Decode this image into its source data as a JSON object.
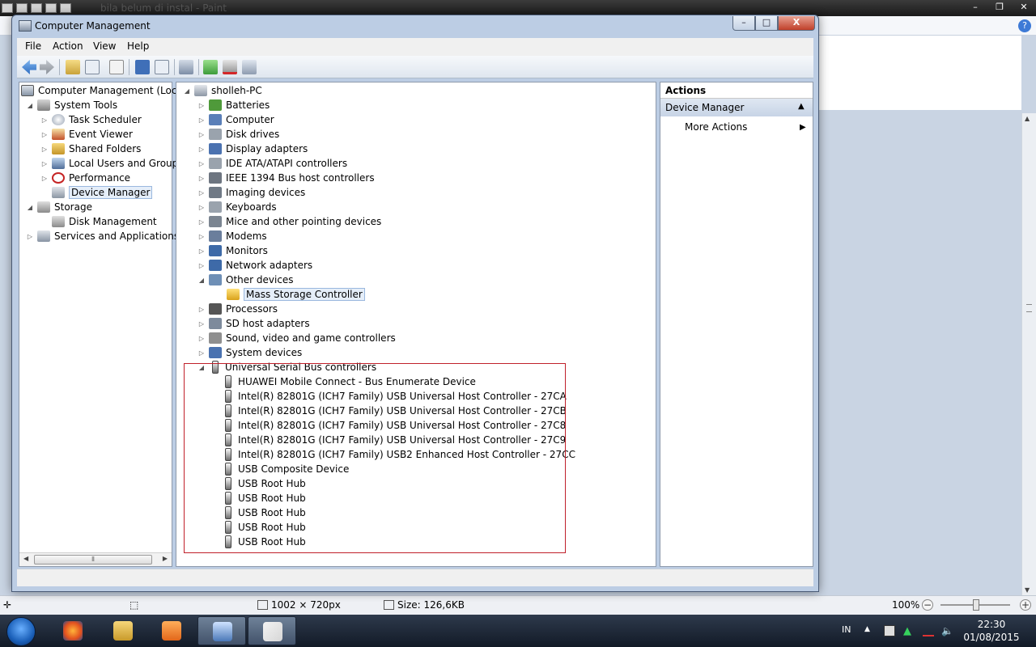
{
  "paint": {
    "title": "bila belum di instal - Paint",
    "help_glyph": "?",
    "status": {
      "dimensions": "1002 × 720px",
      "size": "Size: 126,6KB",
      "zoom": "100%"
    }
  },
  "window": {
    "title": "Computer Management",
    "minimize": "–",
    "maximize": "□",
    "close": "X"
  },
  "menu": [
    "File",
    "Action",
    "View",
    "Help"
  ],
  "tree": {
    "root": "Computer Management (Local",
    "system_tools": "System Tools",
    "items": [
      "Task Scheduler",
      "Event Viewer",
      "Shared Folders",
      "Local Users and Groups",
      "Performance",
      "Device Manager"
    ],
    "storage": "Storage",
    "disk_management": "Disk Management",
    "services": "Services and Applications"
  },
  "devices": {
    "computer": "sholleh-PC",
    "categories": [
      "Batteries",
      "Computer",
      "Disk drives",
      "Display adapters",
      "IDE ATA/ATAPI controllers",
      "IEEE 1394 Bus host controllers",
      "Imaging devices",
      "Keyboards",
      "Mice and other pointing devices",
      "Modems",
      "Monitors",
      "Network adapters",
      "Other devices"
    ],
    "other_child": "Mass Storage Controller",
    "categories_after": [
      "Processors",
      "SD host adapters",
      "Sound, video and game controllers",
      "System devices"
    ],
    "usb_category": "Universal Serial Bus controllers",
    "usb_children": [
      "HUAWEI Mobile Connect - Bus Enumerate Device",
      "Intel(R) 82801G (ICH7 Family) USB Universal Host Controller - 27CA",
      "Intel(R) 82801G (ICH7 Family) USB Universal Host Controller - 27CB",
      "Intel(R) 82801G (ICH7 Family) USB Universal Host Controller - 27C8",
      "Intel(R) 82801G (ICH7 Family) USB Universal Host Controller - 27C9",
      "Intel(R) 82801G (ICH7 Family) USB2 Enhanced Host Controller - 27CC",
      "USB Composite Device",
      "USB Root Hub",
      "USB Root Hub",
      "USB Root Hub",
      "USB Root Hub",
      "USB Root Hub"
    ]
  },
  "actions": {
    "header": "Actions",
    "section": "Device Manager",
    "more": "More Actions"
  },
  "taskbar": {
    "lang": "IN",
    "time": "22:30",
    "date": "01/08/2015"
  }
}
